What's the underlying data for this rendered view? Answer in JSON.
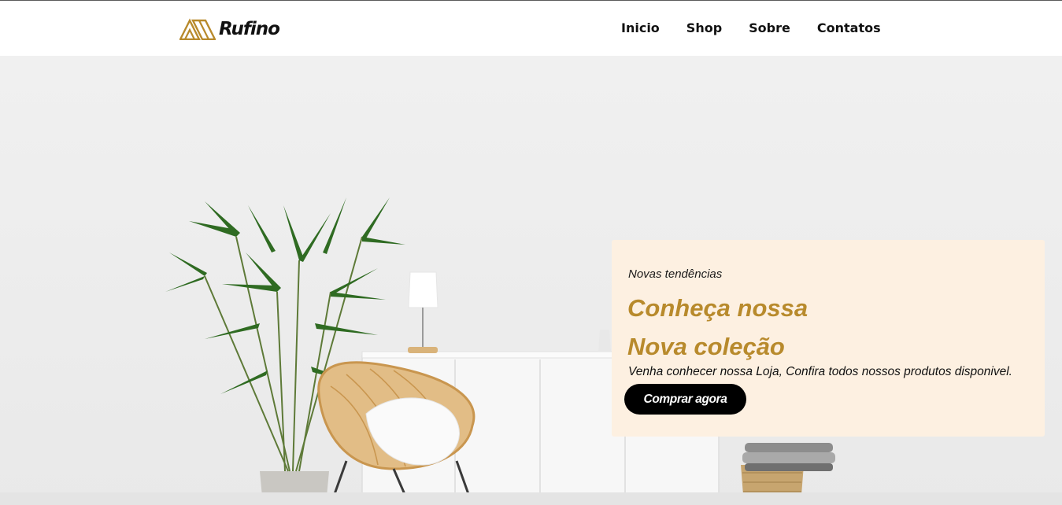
{
  "brand": {
    "name": "Rufino",
    "logo_icon": "triangle-mountain-icon",
    "accent_color": "#b88a2c"
  },
  "nav": {
    "items": [
      {
        "label": "Inicio"
      },
      {
        "label": "Shop"
      },
      {
        "label": "Sobre"
      },
      {
        "label": "Contatos"
      }
    ]
  },
  "hero": {
    "eyebrow": "Novas tendências",
    "headline_line1": "Conheça nossa",
    "headline_line2": "Nova coleção",
    "description": "Venha conhecer nossa Loja, Confira todos nossos produtos disponivel.",
    "cta_label": "Comprar agora",
    "card_color": "#fdf0e1",
    "cta_color": "#000000"
  }
}
